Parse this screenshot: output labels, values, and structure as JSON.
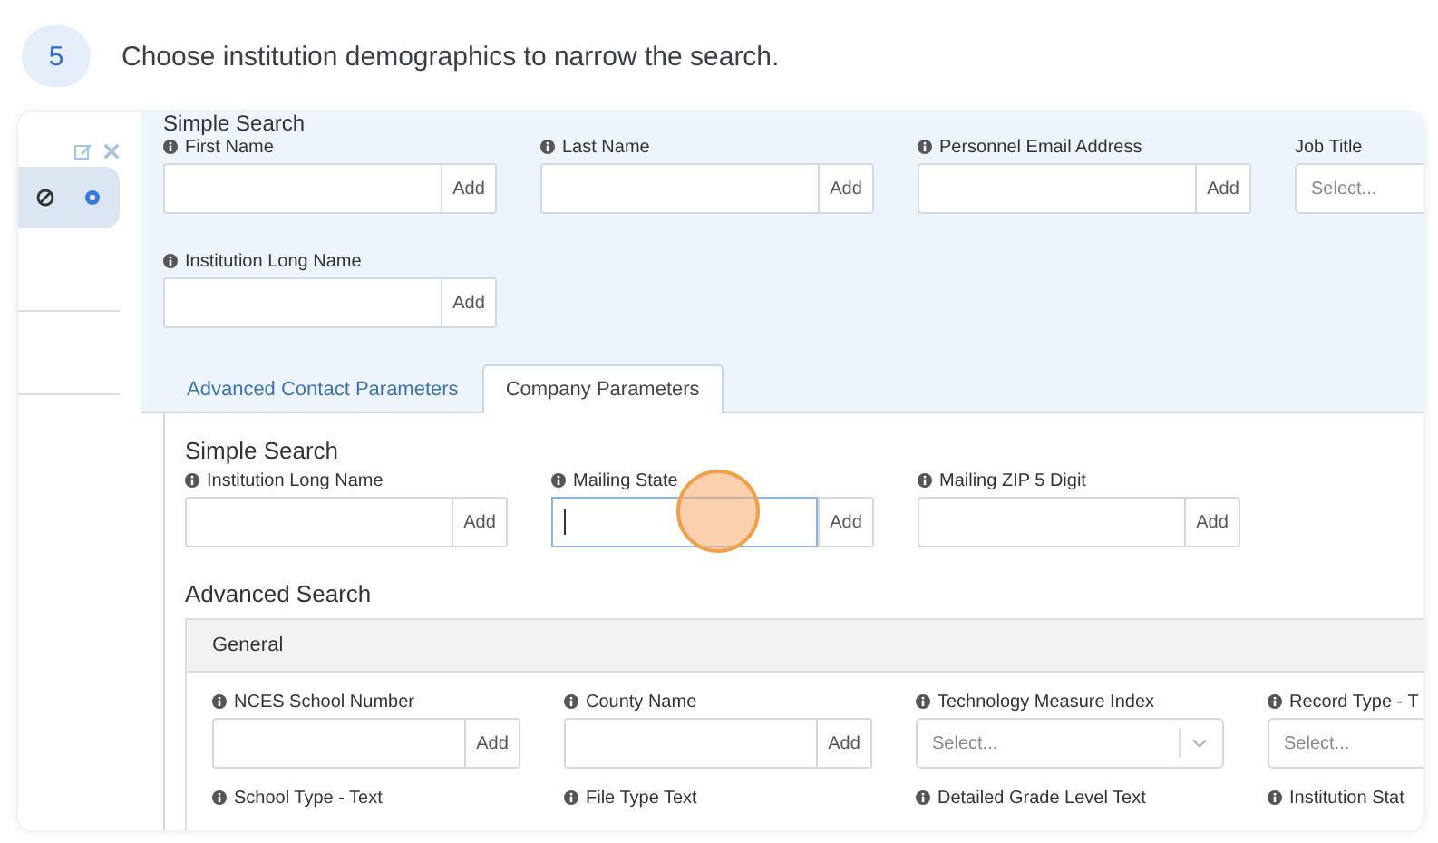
{
  "step": {
    "number": "5",
    "text": "Choose institution demographics to narrow the search."
  },
  "contact_section": {
    "heading": "Simple Search",
    "rows": [
      [
        {
          "kind": "add",
          "info": true,
          "label": "First Name",
          "button": "Add"
        },
        {
          "kind": "add",
          "info": true,
          "label": "Last Name",
          "button": "Add"
        },
        {
          "kind": "add",
          "info": true,
          "label": "Personnel Email Address",
          "button": "Add"
        },
        {
          "kind": "select",
          "info": false,
          "label": "Job Title",
          "placeholder": "Select..."
        }
      ],
      [
        {
          "kind": "add",
          "info": true,
          "label": "Institution Long Name",
          "button": "Add"
        }
      ]
    ]
  },
  "tabs": [
    {
      "label": "Advanced Contact Parameters",
      "selected": false
    },
    {
      "label": "Company Parameters",
      "selected": true
    }
  ],
  "company_parameters": {
    "simple_heading": "Simple Search",
    "simple_fields": [
      {
        "kind": "add",
        "info": true,
        "label": "Institution Long Name",
        "button": "Add",
        "focused": false
      },
      {
        "kind": "add",
        "info": true,
        "label": "Mailing State",
        "button": "Add",
        "focused": true
      },
      {
        "kind": "add",
        "info": true,
        "label": "Mailing ZIP 5 Digit",
        "button": "Add",
        "focused": false
      }
    ],
    "advanced_heading": "Advanced Search",
    "group": {
      "title": "General",
      "rows": [
        [
          {
            "kind": "add",
            "info": true,
            "label": "NCES School Number",
            "button": "Add"
          },
          {
            "kind": "add",
            "info": true,
            "label": "County Name",
            "button": "Add"
          },
          {
            "kind": "select",
            "info": true,
            "label": "Technology Measure Index",
            "placeholder": "Select...",
            "chevron": true
          },
          {
            "kind": "select",
            "info": true,
            "label": "Record Type - T",
            "placeholder": "Select...",
            "chevron": false
          }
        ],
        [
          {
            "kind": "label",
            "info": true,
            "label": "School Type - Text"
          },
          {
            "kind": "label",
            "info": true,
            "label": "File Type Text"
          },
          {
            "kind": "label",
            "info": true,
            "label": "Detailed Grade Level Text"
          },
          {
            "kind": "label",
            "info": true,
            "label": "Institution Stat"
          }
        ]
      ]
    }
  }
}
